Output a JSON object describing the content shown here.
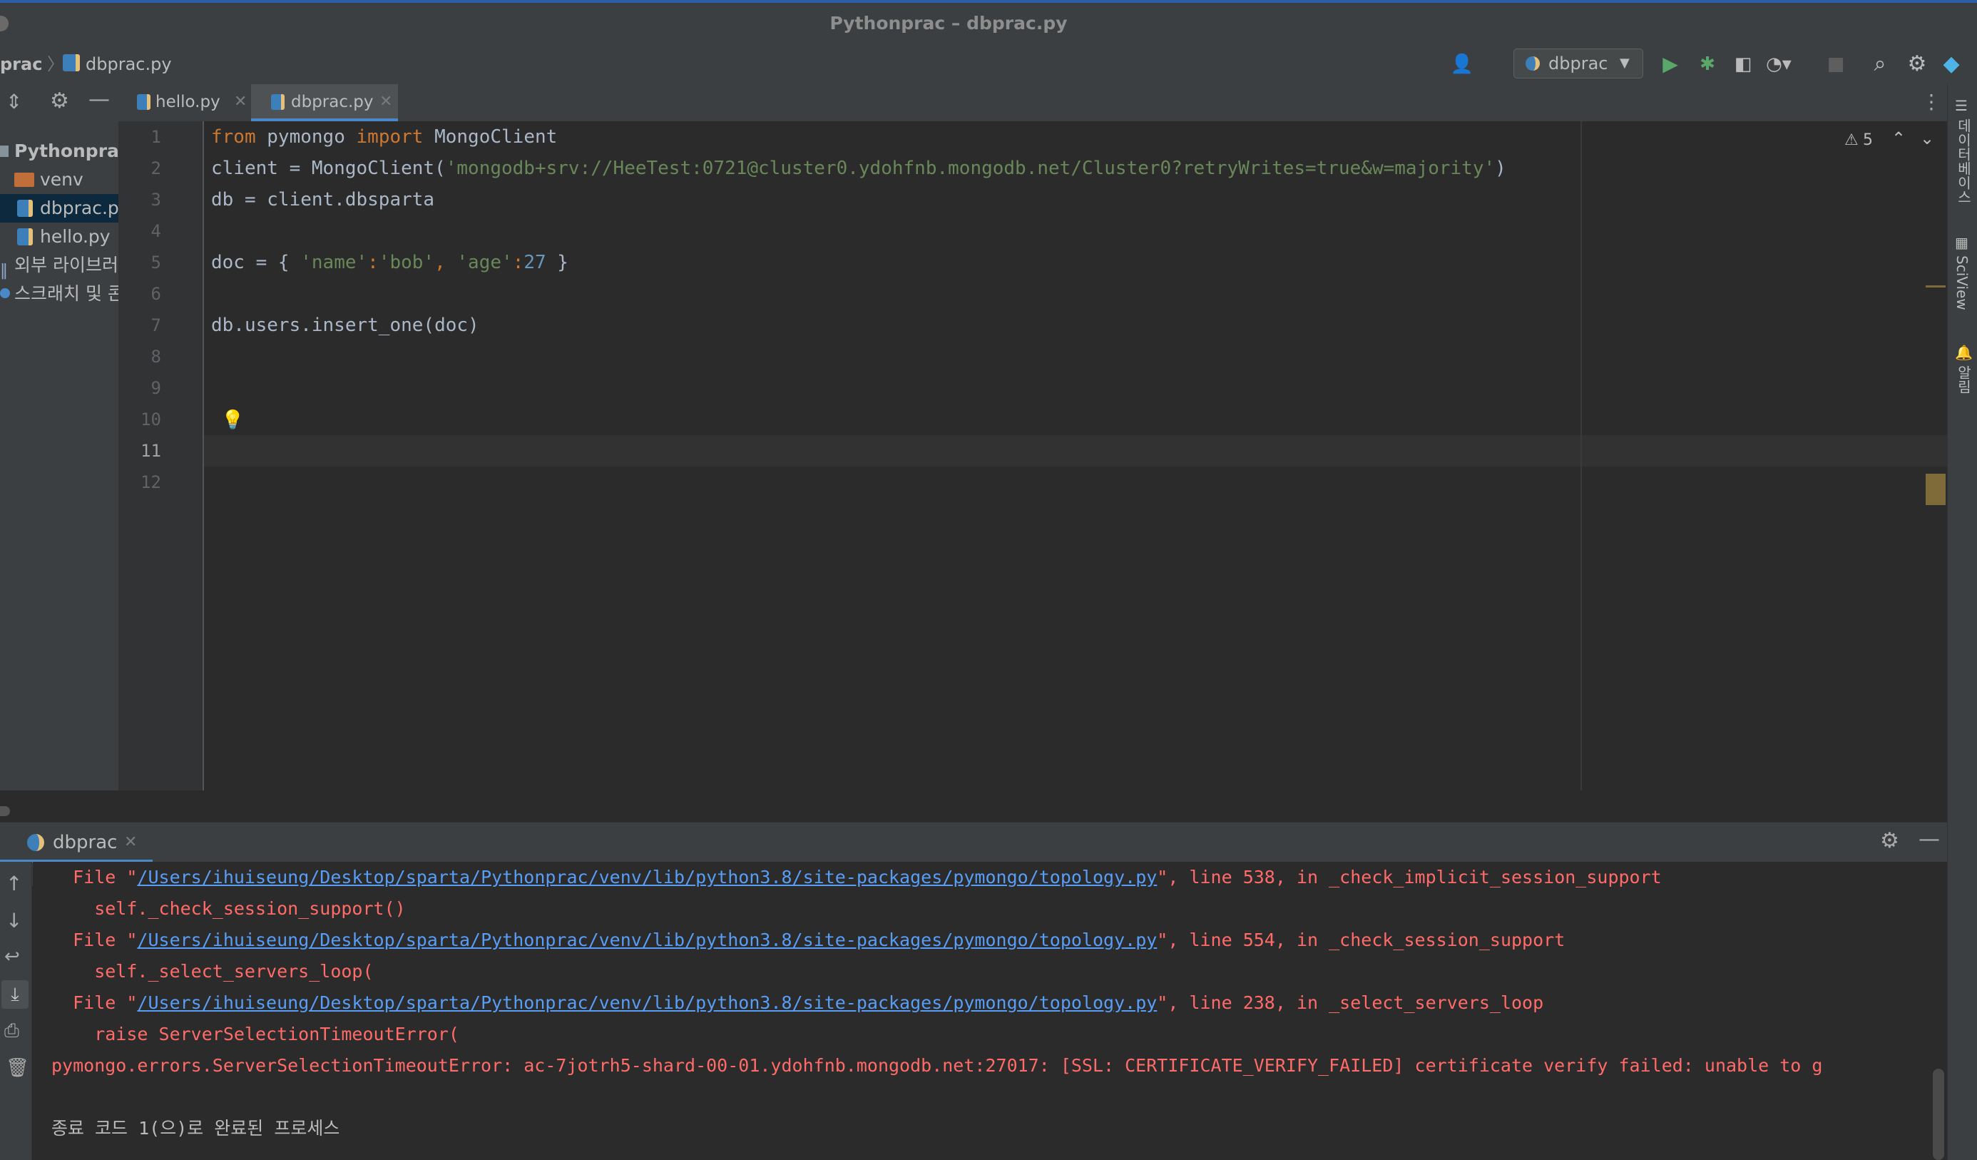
{
  "window": {
    "title": "Pythonprac – dbprac.py"
  },
  "navbar": {
    "breadcrumb_project": "prac",
    "breadcrumb_file": "dbprac.py",
    "run_config": "dbprac"
  },
  "tabs": [
    {
      "label": "hello.py",
      "active": false
    },
    {
      "label": "dbprac.py",
      "active": true
    }
  ],
  "project_tree": [
    {
      "label": "Pythonprac",
      "icon": "folder-icon"
    },
    {
      "label": "venv",
      "icon": "folder-icon"
    },
    {
      "label": "dbprac.py",
      "icon": "python-file-icon",
      "selected": true
    },
    {
      "label": "hello.py",
      "icon": "python-file-icon"
    },
    {
      "label": "외부 라이브러리",
      "icon": "library-icon"
    },
    {
      "label": "스크래치 및 콘솔",
      "icon": "scratch-icon"
    }
  ],
  "editor": {
    "line_numbers": [
      "1",
      "2",
      "3",
      "4",
      "5",
      "6",
      "7",
      "8",
      "9",
      "10",
      "11",
      "12"
    ],
    "lines": {
      "l1_kw1": "from",
      "l1_mid": " pymongo ",
      "l1_kw2": "import",
      "l1_end": " MongoClient",
      "l2_pre": "client = MongoClient(",
      "l2_str": "'mongodb+srv://HeeTest:0721@cluster0.ydohfnb.mongodb.net/Cluster0?retryWrites=true&w=majority'",
      "l2_end": ")",
      "l3": "db = client.dbsparta",
      "l5_pre": "doc = { ",
      "l5_s1": "'name'",
      "l5_c1": ":",
      "l5_s2": "'bob'",
      "l5_c2": ", ",
      "l5_s3": "'age'",
      "l5_c3": ":",
      "l5_n": "27",
      "l5_end": " }",
      "l7": "db.users.insert_one(doc)"
    },
    "warnings_count": "5",
    "current_line": "11"
  },
  "right_strip": {
    "database": "데이터베이스",
    "sciview": "SciView",
    "notifications": "알림"
  },
  "run_panel": {
    "tab_label": "dbprac",
    "console": {
      "l1_pre": "  File \"",
      "path": "/Users/ihuiseung/Desktop/sparta/Pythonprac/venv/lib/python3.8/site-packages/pymongo/topology.py",
      "l1_post": "\", line 538, in _check_implicit_session_support",
      "l2": "    self._check_session_support()",
      "l3_post": "\", line 554, in _check_session_support",
      "l4": "    self._select_servers_loop(",
      "l5_post": "\", line 238, in _select_servers_loop",
      "l6": "    raise ServerSelectionTimeoutError(",
      "l7": "pymongo.errors.ServerSelectionTimeoutError: ac-7jotrh5-shard-00-01.ydohfnb.mongodb.net:27017: [SSL: CERTIFICATE_VERIFY_FAILED] certificate verify failed: unable to g",
      "l9": "종료 코드 1(으)로 완료된 프로세스"
    }
  },
  "colors": {
    "accent": "#4a88c7",
    "error": "#ff6b68",
    "keyword": "#cc7832",
    "string": "#6a8759",
    "number": "#6897bb"
  }
}
